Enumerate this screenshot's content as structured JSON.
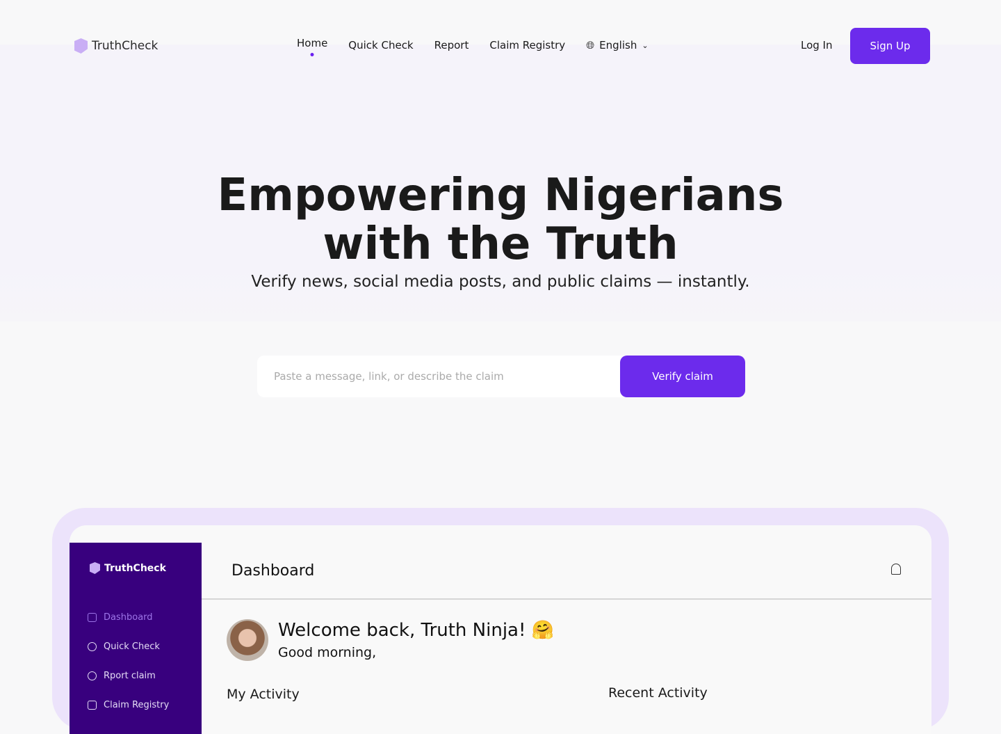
{
  "nav": {
    "brand": "TruthCheck",
    "links": [
      "Home",
      "Quick Check",
      "Report",
      "Claim Registry"
    ],
    "language": "English",
    "login": "Log In",
    "signup": "Sign Up"
  },
  "hero": {
    "title_line1": "Empowering Nigerians",
    "title_line2": "with the Truth",
    "subtitle": "Verify news, social media posts, and public claims — instantly.",
    "search_placeholder": "Paste a message, link, or describe the claim",
    "verify_label": "Verify claim"
  },
  "colors": {
    "accent": "#6c2bec",
    "sidebar": "#38007e",
    "frame": "#ece3fb"
  },
  "dashboard": {
    "brand": "TruthCheck",
    "title": "Dashboard",
    "sidebar": [
      "Dashboard",
      "Quick Check",
      "Rport claim",
      "Claim Registry"
    ],
    "welcome": "Welcome back, Truth Ninja! 🤗",
    "greeting": "Good morning,",
    "my_activity": "My Activity",
    "recent_activity": "Recent Activity"
  }
}
